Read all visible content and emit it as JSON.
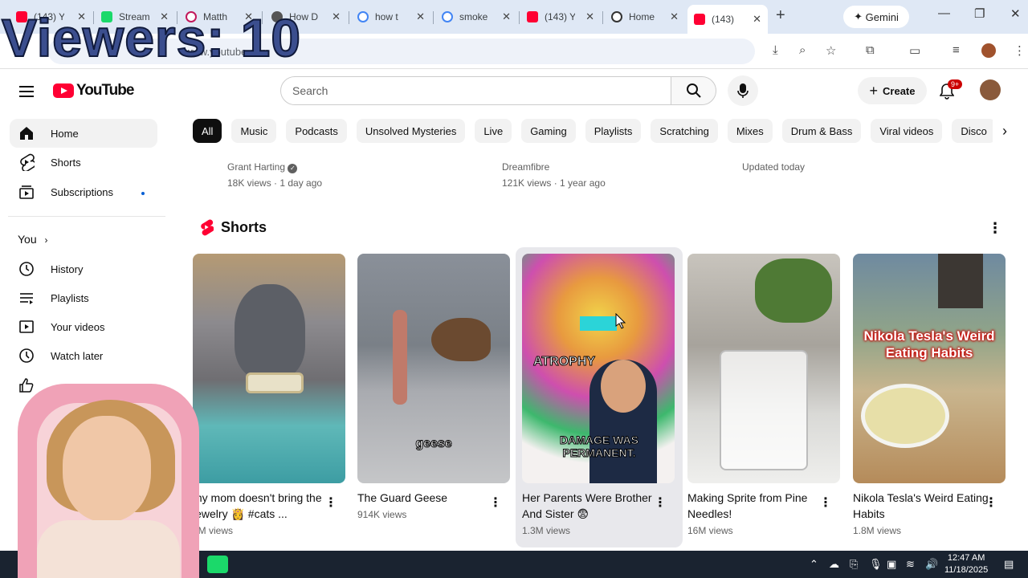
{
  "browser": {
    "tabs": [
      {
        "title": "(143) Y",
        "favicon": "youtube-favicon",
        "color": "#ff0033"
      },
      {
        "title": "Stream",
        "favicon": "kick-favicon",
        "color": "#1bd96a"
      },
      {
        "title": "Matth",
        "favicon": "headset-favicon",
        "color": "#c2185b"
      },
      {
        "title": "How D",
        "favicon": "avatar-favicon",
        "color": "#555555"
      },
      {
        "title": "how t",
        "favicon": "google-favicon",
        "color": "#4285f4"
      },
      {
        "title": "smoke",
        "favicon": "google-favicon",
        "color": "#4285f4"
      },
      {
        "title": "(143) Y",
        "favicon": "youtube-favicon",
        "color": "#ff0033"
      },
      {
        "title": "Home",
        "favicon": "openai-favicon",
        "color": "#333333"
      },
      {
        "title": "(143)",
        "favicon": "youtube-favicon",
        "color": "#ff0033"
      }
    ],
    "gemini_label": "Gemini",
    "url": "www.youtube.com"
  },
  "overlay_text": "Viewers: 10",
  "youtube": {
    "logo_text": "YouTube",
    "search_placeholder": "Search",
    "create_label": "Create",
    "notification_badge": "9+",
    "sidebar": {
      "items": [
        {
          "label": "Home",
          "icon": "home-icon"
        },
        {
          "label": "Shorts",
          "icon": "shorts-icon"
        },
        {
          "label": "Subscriptions",
          "icon": "subscriptions-icon"
        }
      ],
      "you_label": "You",
      "you_items": [
        {
          "label": "History",
          "icon": "history-icon"
        },
        {
          "label": "Playlists",
          "icon": "playlists-icon"
        },
        {
          "label": "Your videos",
          "icon": "your-videos-icon"
        },
        {
          "label": "Watch later",
          "icon": "watch-later-icon"
        }
      ]
    },
    "chips": [
      "All",
      "Music",
      "Podcasts",
      "Unsolved Mysteries",
      "Live",
      "Gaming",
      "Playlists",
      "Scratching",
      "Mixes",
      "Drum & Bass",
      "Viral videos",
      "Disco"
    ],
    "top_row": [
      {
        "channel": "Grant Harting",
        "meta": "18K views · 1 day ago"
      },
      {
        "channel": "Dreamfibre",
        "meta": "121K views · 1 year ago"
      },
      {
        "channel": "Updated today",
        "meta": ""
      }
    ],
    "shorts_heading": "Shorts",
    "shorts": [
      {
        "title": "my mom doesn't bring the jewelry 👸 #cats ...",
        "views": "1M views"
      },
      {
        "title": "The Guard Geese",
        "views": "914K views",
        "caption": "geese"
      },
      {
        "title": "Her Parents Were Brother And Sister 😨",
        "views": "1.3M views",
        "caption_top": "ATROPHY",
        "caption_bottom": "DAMAGE WAS PERMANENT."
      },
      {
        "title": "Making Sprite from Pine Needles!",
        "views": "16M views"
      },
      {
        "title": "Nikola Tesla's Weird Eating Habits",
        "views": "1.8M views",
        "caption": "Nikola Tesla's Weird Eating Habits"
      }
    ]
  },
  "taskbar": {
    "time": "12:47 AM",
    "date": "11/18/2025"
  }
}
